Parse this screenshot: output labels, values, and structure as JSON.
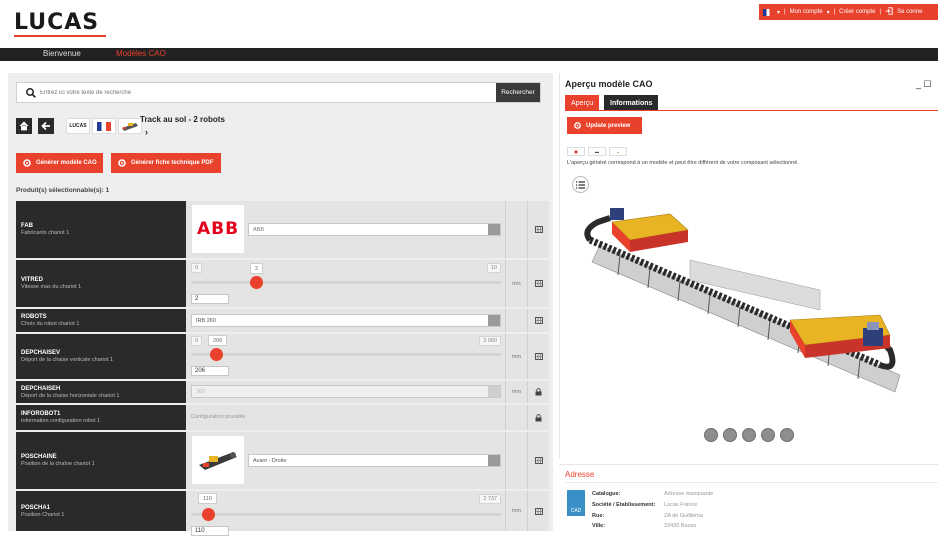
{
  "header": {
    "logo": "LUCAS",
    "user_bar": {
      "language_arrow": "▾",
      "account": "Mon compte",
      "account_arrow": "▾",
      "sep1": "|",
      "sep2": "|",
      "sep3": "|",
      "create_account": "Créer compte",
      "login": "Se conne"
    }
  },
  "nav": {
    "items": [
      {
        "label": "Bienvenue"
      },
      {
        "label": "Modèles CAO"
      }
    ]
  },
  "search": {
    "placeholder": "Entrez ici votre texte de recherche",
    "button": "Rechercher"
  },
  "toolbar": {
    "brand_thumb": "LUCAS",
    "title": "Track au sol - 2 robots",
    "title_arrow": "›"
  },
  "actions": {
    "generate_cad": "Générer modèle CAO",
    "generate_pdf": "Générer fiche technique PDF"
  },
  "products_count": "Produit(s) sélectionnable(s): 1",
  "rows": [
    {
      "code": "FAB",
      "desc": "Fabricants chariot 1",
      "logo": "ABB",
      "value": "ABB"
    },
    {
      "code": "VITRED",
      "desc": "Vitesse max du chariot 1",
      "min": "0",
      "max": "10",
      "current": "2",
      "value": "2",
      "unit": "m/s",
      "fraction": 0.2
    },
    {
      "code": "ROBOTS",
      "desc": "Choix du robot chariot 1",
      "value": "IRB 260"
    },
    {
      "code": "DEPCHAISEV",
      "desc": "Déport de la chaise verticale chariot 1",
      "min": "0",
      "max": "3 000",
      "current": "206",
      "value": "206",
      "unit": "mm",
      "fraction": 0.0687
    },
    {
      "code": "DEPCHAISEH",
      "desc": "Déport de la chaise horizontale chariot 1",
      "value": "300",
      "unit": "mm"
    },
    {
      "code": "INFOROBOT1",
      "desc": "Information configuration robot 1",
      "value": "Configuration possible"
    },
    {
      "code": "POSCHAINE",
      "desc": "Position de la chaîne chariot 1",
      "value": "Avant - Droite"
    },
    {
      "code": "POSCHA1",
      "desc": "Position Chariot 1",
      "max": "2 737",
      "current": "110",
      "value": "110",
      "unit": "mm",
      "fraction": 0.0402
    }
  ],
  "preview": {
    "title": "Aperçu modèle CAO",
    "window_controls": "_ ☐",
    "tabs": [
      {
        "label": "Aperçu"
      },
      {
        "label": "Informations"
      }
    ],
    "update_button": "Update preview",
    "note": "L'aperçu généré correspond à un modèle et peut être différent de votre composant sélectionné."
  },
  "address": {
    "title": "Adresse",
    "logo_text": "CAD",
    "fields": [
      {
        "key": "Catalogue:",
        "value": "Adresse manquante"
      },
      {
        "key": "Société / Etablissement:",
        "value": "Lucas France"
      },
      {
        "key": "Rue:",
        "value": "ZA de Guilliéma"
      },
      {
        "key": "Ville:",
        "value": "33430 Bazas"
      }
    ]
  },
  "colors": {
    "accent": "#e8412c",
    "dark": "#2a2a2a",
    "panel": "#eeeeee"
  }
}
